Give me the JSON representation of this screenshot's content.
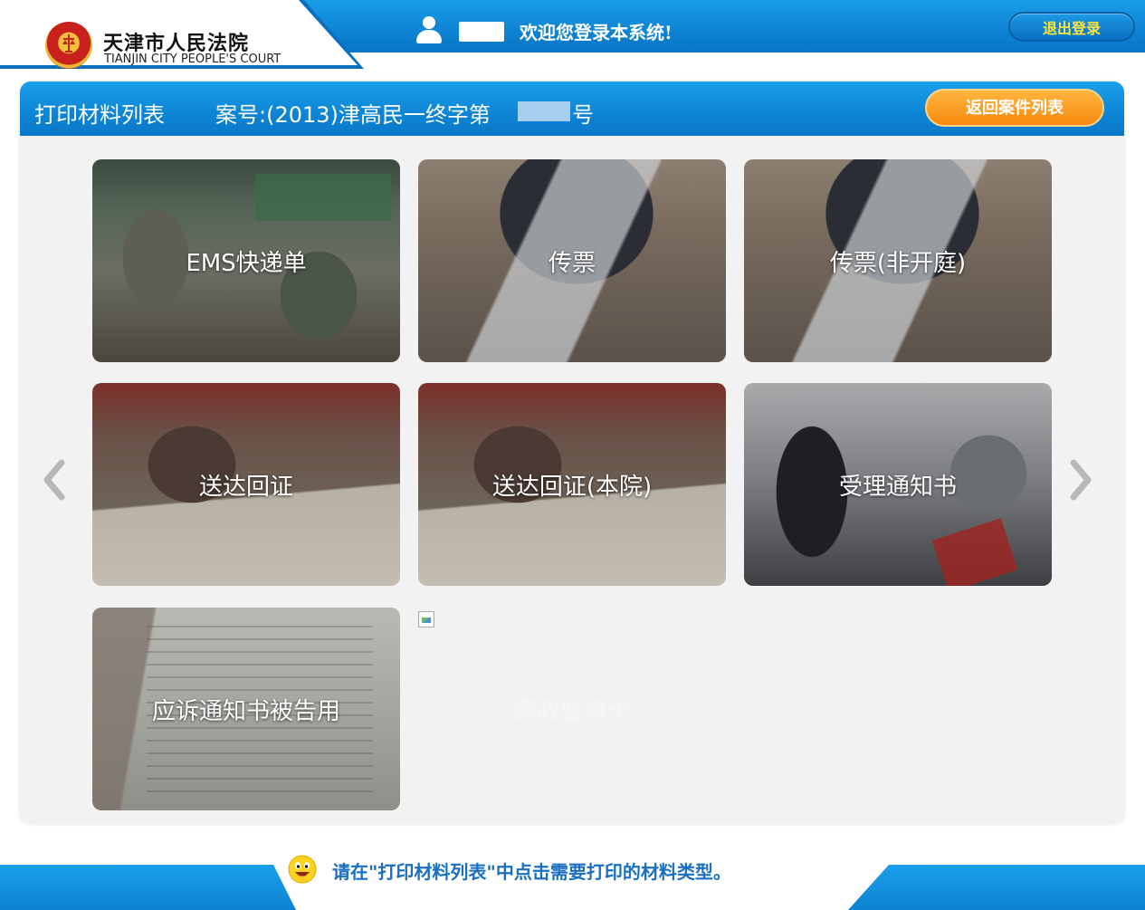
{
  "header": {
    "court_name_cn": "天津市人民法院",
    "court_name_en": "TIANJIN CITY PEOPLE'S COURT",
    "welcome_text": "欢迎您登录本系统!",
    "logout_label": "退出登录"
  },
  "panel": {
    "title": "打印材料列表",
    "case_label": "案号:(2013)津高民一终字第",
    "case_suffix": "号",
    "back_label": "返回案件列表"
  },
  "tiles": [
    {
      "label": "EMS快递单"
    },
    {
      "label": "传票"
    },
    {
      "label": "传票(非开庭)"
    },
    {
      "label": "送达回证"
    },
    {
      "label": "送达回证(本院)"
    },
    {
      "label": "受理通知书"
    },
    {
      "label": "应诉通知书被告用"
    },
    {
      "label": "廉政监督卡"
    }
  ],
  "footer": {
    "hint": "请在\"打印材料列表\"中点击需要打印的材料类型。"
  },
  "colors": {
    "primary_blue": "#0d84d5",
    "orange_button": "#f6890d",
    "logout_text": "#ffe43a",
    "hint_text": "#1a6fc0"
  },
  "icons": [
    "court-emblem-icon",
    "user-icon",
    "chevron-left-icon",
    "chevron-right-icon",
    "smiley-icon",
    "broken-image-icon"
  ]
}
